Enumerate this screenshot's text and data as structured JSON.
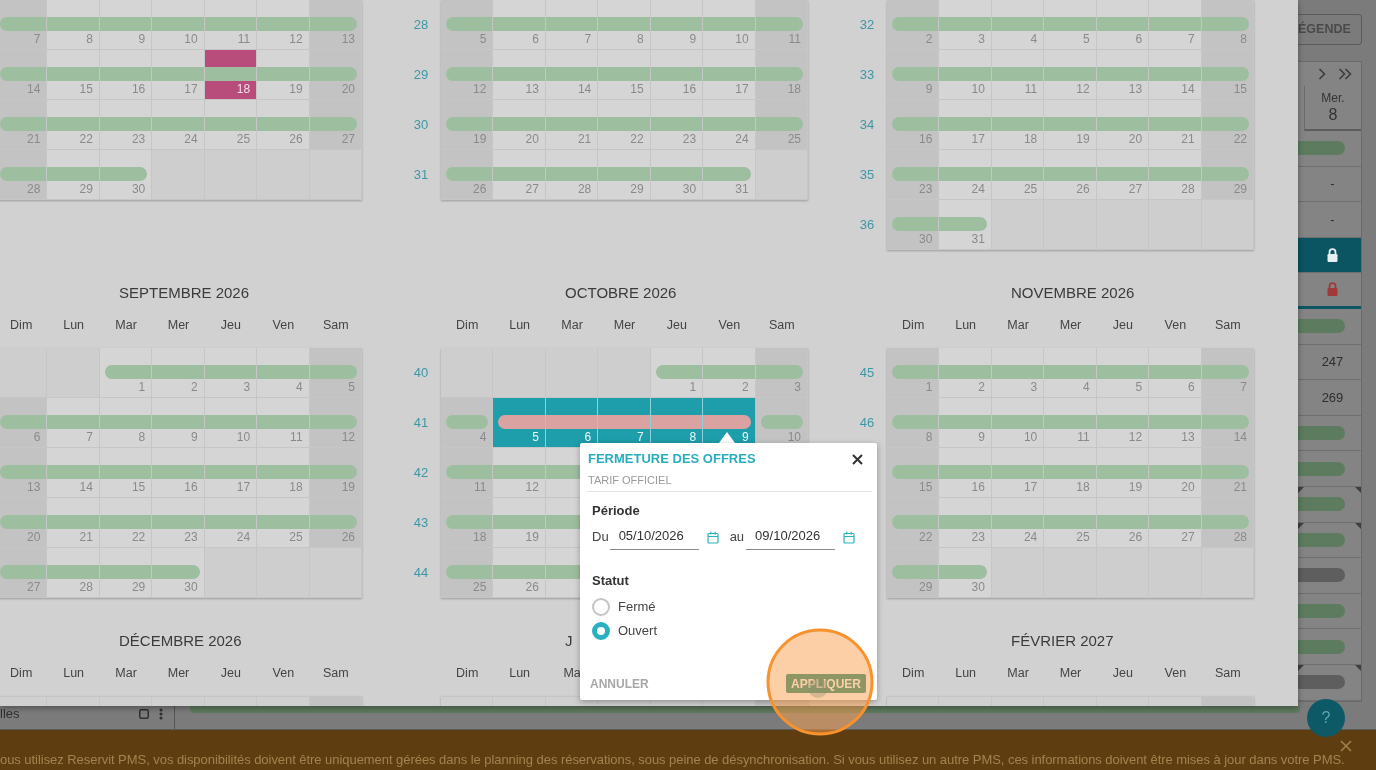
{
  "calendar_modal": {
    "month_rows": [
      [
        {
          "weeks": [
            {
              "days": [
                {
                  "day": "7",
                  "kind": "open",
                  "selected": false
                },
                {
                  "day": "8",
                  "kind": "open",
                  "selected": false
                },
                {
                  "day": "9",
                  "kind": "open",
                  "selected": false
                },
                {
                  "day": "10",
                  "kind": "open",
                  "selected": false
                },
                {
                  "day": "11",
                  "kind": "open",
                  "selected": false
                },
                {
                  "day": "12",
                  "kind": "open",
                  "selected": false
                },
                {
                  "day": "13",
                  "kind": "open",
                  "selected": false
                }
              ]
            },
            {
              "days": [
                {
                  "day": "14",
                  "kind": "open",
                  "selected": false
                },
                {
                  "day": "15",
                  "kind": "open",
                  "selected": false
                },
                {
                  "day": "16",
                  "kind": "open",
                  "selected": false
                },
                {
                  "day": "17",
                  "kind": "open",
                  "selected": false
                },
                {
                  "day": "18",
                  "kind": "open",
                  "selected": false,
                  "color": "#b84c7b"
                },
                {
                  "day": "19",
                  "kind": "open",
                  "selected": false
                },
                {
                  "day": "20",
                  "kind": "open",
                  "selected": false
                }
              ]
            },
            {
              "days": [
                {
                  "day": "21",
                  "kind": "open",
                  "selected": false
                },
                {
                  "day": "22",
                  "kind": "open",
                  "selected": false
                },
                {
                  "day": "23",
                  "kind": "open",
                  "selected": false
                },
                {
                  "day": "24",
                  "kind": "open",
                  "selected": false
                },
                {
                  "day": "25",
                  "kind": "open",
                  "selected": false
                },
                {
                  "day": "26",
                  "kind": "open",
                  "selected": false
                },
                {
                  "day": "27",
                  "kind": "open",
                  "selected": false
                }
              ]
            },
            {
              "days": [
                {
                  "day": "28",
                  "kind": "open",
                  "selected": false
                },
                {
                  "day": "29",
                  "kind": "open",
                  "selected": false
                },
                {
                  "day": "30",
                  "kind": "open",
                  "selected": false
                },
                {
                  "kind": "blank"
                },
                {
                  "kind": "blank"
                },
                {
                  "kind": "blank"
                },
                {
                  "kind": "blank"
                }
              ]
            }
          ]
        },
        {
          "weeks": [
            {
              "number": "28",
              "days": [
                {
                  "day": "5",
                  "kind": "open",
                  "selected": false
                },
                {
                  "day": "6",
                  "kind": "open",
                  "selected": false
                },
                {
                  "day": "7",
                  "kind": "open",
                  "selected": false
                },
                {
                  "day": "8",
                  "kind": "open",
                  "selected": false
                },
                {
                  "day": "9",
                  "kind": "open",
                  "selected": false
                },
                {
                  "day": "10",
                  "kind": "open",
                  "selected": false
                },
                {
                  "day": "11",
                  "kind": "open",
                  "selected": false
                }
              ]
            },
            {
              "number": "29",
              "days": [
                {
                  "day": "12",
                  "kind": "open",
                  "selected": false
                },
                {
                  "day": "13",
                  "kind": "open",
                  "selected": false
                },
                {
                  "day": "14",
                  "kind": "open",
                  "selected": false
                },
                {
                  "day": "15",
                  "kind": "open",
                  "selected": false
                },
                {
                  "day": "16",
                  "kind": "open",
                  "selected": false
                },
                {
                  "day": "17",
                  "kind": "open",
                  "selected": false
                },
                {
                  "day": "18",
                  "kind": "open",
                  "selected": false
                }
              ]
            },
            {
              "number": "30",
              "days": [
                {
                  "day": "19",
                  "kind": "open",
                  "selected": false
                },
                {
                  "day": "20",
                  "kind": "open",
                  "selected": false
                },
                {
                  "day": "21",
                  "kind": "open",
                  "selected": false
                },
                {
                  "day": "22",
                  "kind": "open",
                  "selected": false
                },
                {
                  "day": "23",
                  "kind": "open",
                  "selected": false
                },
                {
                  "day": "24",
                  "kind": "open",
                  "selected": false
                },
                {
                  "day": "25",
                  "kind": "open",
                  "selected": false
                }
              ]
            },
            {
              "number": "31",
              "days": [
                {
                  "day": "26",
                  "kind": "open",
                  "selected": false
                },
                {
                  "day": "27",
                  "kind": "open",
                  "selected": false
                },
                {
                  "day": "28",
                  "kind": "open",
                  "selected": false
                },
                {
                  "day": "29",
                  "kind": "open",
                  "selected": false
                },
                {
                  "day": "30",
                  "kind": "open",
                  "selected": false
                },
                {
                  "day": "31",
                  "kind": "open",
                  "selected": false
                },
                {
                  "kind": "blank"
                }
              ]
            }
          ]
        },
        {
          "weeks": [
            {
              "number": "32",
              "days": [
                {
                  "day": "2",
                  "kind": "open",
                  "selected": false
                },
                {
                  "day": "3",
                  "kind": "open",
                  "selected": false
                },
                {
                  "day": "4",
                  "kind": "open",
                  "selected": false
                },
                {
                  "day": "5",
                  "kind": "open",
                  "selected": false
                },
                {
                  "day": "6",
                  "kind": "open",
                  "selected": false
                },
                {
                  "day": "7",
                  "kind": "open",
                  "selected": false
                },
                {
                  "day": "8",
                  "kind": "open",
                  "selected": false
                }
              ]
            },
            {
              "number": "33",
              "days": [
                {
                  "day": "9",
                  "kind": "open",
                  "selected": false
                },
                {
                  "day": "10",
                  "kind": "open",
                  "selected": false
                },
                {
                  "day": "11",
                  "kind": "open",
                  "selected": false
                },
                {
                  "day": "12",
                  "kind": "open",
                  "selected": false
                },
                {
                  "day": "13",
                  "kind": "open",
                  "selected": false
                },
                {
                  "day": "14",
                  "kind": "open",
                  "selected": false
                },
                {
                  "day": "15",
                  "kind": "open",
                  "selected": false
                }
              ]
            },
            {
              "number": "34",
              "days": [
                {
                  "day": "16",
                  "kind": "open",
                  "selected": false
                },
                {
                  "day": "17",
                  "kind": "open",
                  "selected": false
                },
                {
                  "day": "18",
                  "kind": "open",
                  "selected": false
                },
                {
                  "day": "19",
                  "kind": "open",
                  "selected": false
                },
                {
                  "day": "20",
                  "kind": "open",
                  "selected": false
                },
                {
                  "day": "21",
                  "kind": "open",
                  "selected": false
                },
                {
                  "day": "22",
                  "kind": "open",
                  "selected": false
                }
              ]
            },
            {
              "number": "35",
              "days": [
                {
                  "day": "23",
                  "kind": "open",
                  "selected": false
                },
                {
                  "day": "24",
                  "kind": "open",
                  "selected": false
                },
                {
                  "day": "25",
                  "kind": "open",
                  "selected": false
                },
                {
                  "day": "26",
                  "kind": "open",
                  "selected": false
                },
                {
                  "day": "27",
                  "kind": "open",
                  "selected": false
                },
                {
                  "day": "28",
                  "kind": "open",
                  "selected": false
                },
                {
                  "day": "29",
                  "kind": "open",
                  "selected": false
                }
              ]
            },
            {
              "number": "36",
              "days": [
                {
                  "day": "30",
                  "kind": "open",
                  "selected": false
                },
                {
                  "day": "31",
                  "kind": "open",
                  "selected": false
                },
                {
                  "kind": "blank"
                },
                {
                  "kind": "blank"
                },
                {
                  "kind": "blank"
                },
                {
                  "kind": "blank"
                },
                {
                  "kind": "blank"
                }
              ]
            }
          ]
        }
      ],
      [
        {
          "title": "SEPTEMBRE 2026",
          "weekdays": [
            "Dim",
            "Lun",
            "Mar",
            "Mer",
            "Jeu",
            "Ven",
            "Sam"
          ],
          "weeks": [
            {
              "days": [
                {
                  "kind": "blank"
                },
                {
                  "kind": "blank"
                },
                {
                  "day": "1",
                  "kind": "open",
                  "selected": false
                },
                {
                  "day": "2",
                  "kind": "open",
                  "selected": false
                },
                {
                  "day": "3",
                  "kind": "open",
                  "selected": false
                },
                {
                  "day": "4",
                  "kind": "open",
                  "selected": false
                },
                {
                  "day": "5",
                  "kind": "open",
                  "selected": false
                }
              ]
            },
            {
              "days": [
                {
                  "day": "6",
                  "kind": "open",
                  "selected": false
                },
                {
                  "day": "7",
                  "kind": "open",
                  "selected": false
                },
                {
                  "day": "8",
                  "kind": "open",
                  "selected": false
                },
                {
                  "day": "9",
                  "kind": "open",
                  "selected": false
                },
                {
                  "day": "10",
                  "kind": "open",
                  "selected": false
                },
                {
                  "day": "11",
                  "kind": "open",
                  "selected": false
                },
                {
                  "day": "12",
                  "kind": "open",
                  "selected": false
                }
              ]
            },
            {
              "days": [
                {
                  "day": "13",
                  "kind": "open",
                  "selected": false
                },
                {
                  "day": "14",
                  "kind": "open",
                  "selected": false
                },
                {
                  "day": "15",
                  "kind": "open",
                  "selected": false
                },
                {
                  "day": "16",
                  "kind": "open",
                  "selected": false
                },
                {
                  "day": "17",
                  "kind": "open",
                  "selected": false
                },
                {
                  "day": "18",
                  "kind": "open",
                  "selected": false
                },
                {
                  "day": "19",
                  "kind": "open",
                  "selected": false
                }
              ]
            },
            {
              "days": [
                {
                  "day": "20",
                  "kind": "open",
                  "selected": false
                },
                {
                  "day": "21",
                  "kind": "open",
                  "selected": false
                },
                {
                  "day": "22",
                  "kind": "open",
                  "selected": false
                },
                {
                  "day": "23",
                  "kind": "open",
                  "selected": false
                },
                {
                  "day": "24",
                  "kind": "open",
                  "selected": false
                },
                {
                  "day": "25",
                  "kind": "open",
                  "selected": false
                },
                {
                  "day": "26",
                  "kind": "open",
                  "selected": false
                }
              ]
            },
            {
              "days": [
                {
                  "day": "27",
                  "kind": "open",
                  "selected": false
                },
                {
                  "day": "28",
                  "kind": "open",
                  "selected": false
                },
                {
                  "day": "29",
                  "kind": "open",
                  "selected": false
                },
                {
                  "day": "30",
                  "kind": "open",
                  "selected": false
                },
                {
                  "kind": "blank"
                },
                {
                  "kind": "blank"
                },
                {
                  "kind": "blank"
                }
              ]
            }
          ]
        },
        {
          "title": "OCTOBRE 2026",
          "weekdays": [
            "Dim",
            "Lun",
            "Mar",
            "Mer",
            "Jeu",
            "Ven",
            "Sam"
          ],
          "weeks": [
            {
              "number": "40",
              "days": [
                {
                  "kind": "blank"
                },
                {
                  "kind": "blank"
                },
                {
                  "kind": "blank"
                },
                {
                  "kind": "blank"
                },
                {
                  "day": "1",
                  "kind": "open",
                  "selected": false
                },
                {
                  "day": "2",
                  "kind": "open",
                  "selected": false
                },
                {
                  "day": "3",
                  "kind": "open",
                  "selected": false
                }
              ]
            },
            {
              "number": "41",
              "days": [
                {
                  "day": "4",
                  "kind": "open",
                  "selected": false
                },
                {
                  "day": "5",
                  "kind": "closed",
                  "selected": true
                },
                {
                  "day": "6",
                  "kind": "closed",
                  "selected": true
                },
                {
                  "day": "7",
                  "kind": "closed",
                  "selected": true
                },
                {
                  "day": "8",
                  "kind": "closed",
                  "selected": true
                },
                {
                  "day": "9",
                  "kind": "closed",
                  "selected": true
                },
                {
                  "day": "10",
                  "kind": "open",
                  "selected": false
                }
              ]
            },
            {
              "number": "42",
              "days": [
                {
                  "day": "11",
                  "kind": "open",
                  "selected": false
                },
                {
                  "day": "12",
                  "kind": "open",
                  "selected": false
                },
                {
                  "kind": "open",
                  "selected": false
                }
              ]
            },
            {
              "number": "43",
              "days": [
                {
                  "day": "18",
                  "kind": "open",
                  "selected": false
                },
                {
                  "day": "19",
                  "kind": "open",
                  "selected": false
                },
                {
                  "kind": "open",
                  "selected": false
                }
              ]
            },
            {
              "number": "44",
              "days": [
                {
                  "day": "25",
                  "kind": "open",
                  "selected": false
                },
                {
                  "day": "26",
                  "kind": "open",
                  "selected": false
                },
                {
                  "kind": "open",
                  "selected": false
                }
              ]
            }
          ]
        },
        {
          "title": "NOVEMBRE 2026",
          "weekdays": [
            "Dim",
            "Lun",
            "Mar",
            "Mer",
            "Jeu",
            "Ven",
            "Sam"
          ],
          "weeks": [
            {
              "number": "45",
              "days": [
                {
                  "day": "1",
                  "kind": "open",
                  "selected": false
                },
                {
                  "day": "2",
                  "kind": "open",
                  "selected": false
                },
                {
                  "day": "3",
                  "kind": "open",
                  "selected": false
                },
                {
                  "day": "4",
                  "kind": "open",
                  "selected": false
                },
                {
                  "day": "5",
                  "kind": "open",
                  "selected": false
                },
                {
                  "day": "6",
                  "kind": "open",
                  "selected": false
                },
                {
                  "day": "7",
                  "kind": "open",
                  "selected": false
                }
              ]
            },
            {
              "number": "46",
              "days": [
                {
                  "day": "8",
                  "kind": "open",
                  "selected": false
                },
                {
                  "day": "9",
                  "kind": "open",
                  "selected": false
                },
                {
                  "day": "10",
                  "kind": "open",
                  "selected": false
                },
                {
                  "day": "11",
                  "kind": "open",
                  "selected": false
                },
                {
                  "day": "12",
                  "kind": "open",
                  "selected": false
                },
                {
                  "day": "13",
                  "kind": "open",
                  "selected": false
                },
                {
                  "day": "14",
                  "kind": "open",
                  "selected": false
                }
              ]
            },
            {
              "days": [
                {
                  "day": "15",
                  "kind": "open",
                  "selected": false
                },
                {
                  "day": "16",
                  "kind": "open",
                  "selected": false
                },
                {
                  "day": "17",
                  "kind": "open",
                  "selected": false
                },
                {
                  "day": "18",
                  "kind": "open",
                  "selected": false
                },
                {
                  "day": "19",
                  "kind": "open",
                  "selected": false
                },
                {
                  "day": "20",
                  "kind": "open",
                  "selected": false
                },
                {
                  "day": "21",
                  "kind": "open",
                  "selected": false
                }
              ]
            },
            {
              "days": [
                {
                  "day": "22",
                  "kind": "open",
                  "selected": false
                },
                {
                  "day": "23",
                  "kind": "open",
                  "selected": false
                },
                {
                  "day": "24",
                  "kind": "open",
                  "selected": false
                },
                {
                  "day": "25",
                  "kind": "open",
                  "selected": false
                },
                {
                  "day": "26",
                  "kind": "open",
                  "selected": false
                },
                {
                  "day": "27",
                  "kind": "open",
                  "selected": false
                },
                {
                  "day": "28",
                  "kind": "open",
                  "selected": false
                }
              ]
            },
            {
              "days": [
                {
                  "day": "29",
                  "kind": "open",
                  "selected": false
                },
                {
                  "day": "30",
                  "kind": "open",
                  "selected": false
                },
                {
                  "kind": "blank"
                },
                {
                  "kind": "blank"
                },
                {
                  "kind": "blank"
                },
                {
                  "kind": "blank"
                },
                {
                  "kind": "blank"
                }
              ]
            }
          ]
        }
      ],
      [
        {
          "title": "DÉCEMBRE 2026",
          "weekdays": [
            "Dim",
            "Lun",
            "Mar",
            "Mer",
            "Jeu",
            "Ven",
            "Sam"
          ]
        },
        {
          "title": "J",
          "weekdays": [
            "Dim",
            "Lun",
            "Ma"
          ]
        },
        {
          "title": "FÉVRIER 2027",
          "weekdays": [
            "Dim",
            "Lun",
            "Mar",
            "Mer",
            "Jeu",
            "Ven",
            "Sam"
          ]
        }
      ]
    ]
  },
  "popover": {
    "title": "FERMETURE DES OFFRES",
    "subtitle": "TARIF OFFICIEL",
    "period_label": "Période",
    "from_label": "Du",
    "from_value": "05/10/2026",
    "to_label": "au",
    "to_value": "09/10/2026",
    "status_label": "Statut",
    "options": [
      {
        "label": "Fermé",
        "selected": false
      },
      {
        "label": "Ouvert",
        "selected": true
      }
    ],
    "cancel": "ANNULER",
    "apply": "APPLIQUER"
  },
  "planning": {
    "legend_button": "ÉGENDE",
    "weekday": "Mer.",
    "day": "8",
    "rows": [
      {
        "kind": "bar",
        "marked": false
      },
      {
        "kind": "value",
        "text": "-"
      },
      {
        "kind": "value",
        "text": "-"
      },
      {
        "kind": "closed"
      },
      {
        "kind": "lock"
      },
      {
        "kind": "bar",
        "marked": false
      },
      {
        "kind": "value",
        "text": "247"
      },
      {
        "kind": "value",
        "text": "269"
      },
      {
        "kind": "bar",
        "marked": false
      },
      {
        "kind": "bar",
        "marked": false
      },
      {
        "kind": "bar",
        "marked": true
      },
      {
        "kind": "bar",
        "marked": true
      },
      {
        "kind": "empty-bar",
        "marked": false
      },
      {
        "kind": "bar",
        "marked": false
      },
      {
        "kind": "bar",
        "marked": false
      },
      {
        "kind": "empty-bar",
        "marked": true
      }
    ]
  },
  "footer_row": {
    "label": "lles"
  },
  "notice": {
    "text": "ous utilisez Reservit PMS, vos disponibilités doivent être uniquement gérées dans le planning des réservations, sous peine de désynchronisation. Si vous utilisez un autre PMS, ces informations doivent être mises à jour dans votre PMS."
  },
  "help_button": "?"
}
